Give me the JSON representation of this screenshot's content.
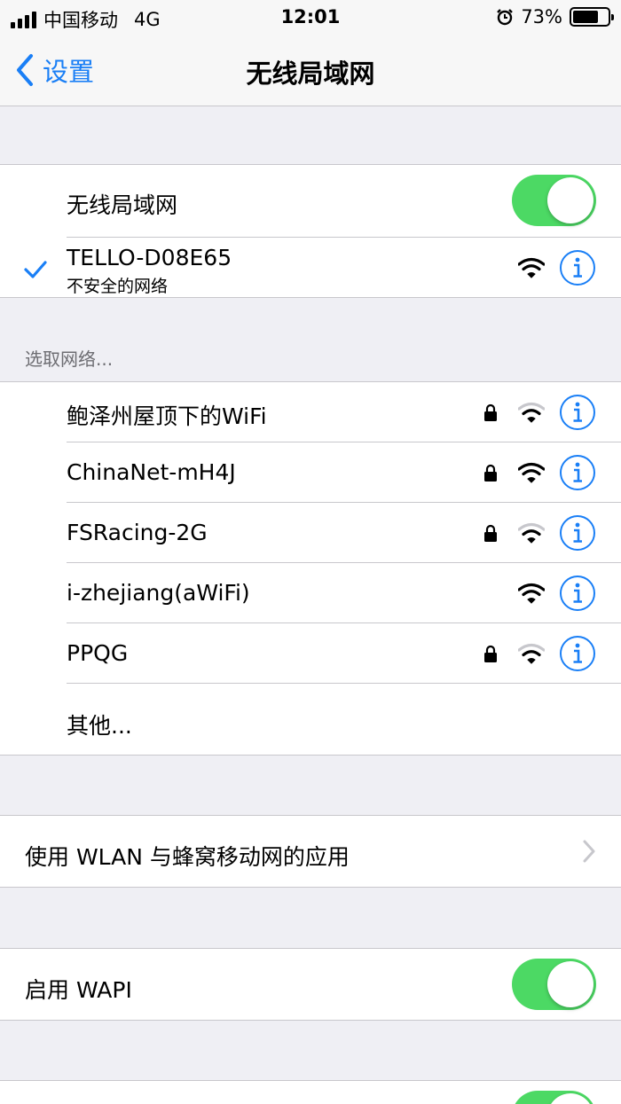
{
  "status_bar": {
    "carrier": "中国移动",
    "network": "4G",
    "time": "12:01",
    "battery": "73%",
    "battery_level": 0.73
  },
  "nav": {
    "back_label": "设置",
    "title": "无线局域网"
  },
  "wlan_toggle": {
    "label": "无线局域网",
    "on": true
  },
  "connected": {
    "ssid": "TELLO-D08E65",
    "subtitle": "不安全的网络",
    "locked": false,
    "signal": "full"
  },
  "choose_header": "选取网络...",
  "networks": [
    {
      "ssid": "鲍泽州屋顶下的WiFi",
      "locked": true,
      "signal": "medium"
    },
    {
      "ssid": "ChinaNet-mH4J",
      "locked": true,
      "signal": "full"
    },
    {
      "ssid": "FSRacing-2G",
      "locked": true,
      "signal": "medium"
    },
    {
      "ssid": "i-zhejiang(aWiFi)",
      "locked": false,
      "signal": "full"
    },
    {
      "ssid": "PPQG",
      "locked": true,
      "signal": "medium"
    }
  ],
  "other_label": "其他...",
  "apps_row": {
    "label": "使用 WLAN 与蜂窝移动网的应用"
  },
  "wapi": {
    "label": "启用 WAPI",
    "on": true
  },
  "colors": {
    "accent": "#1a7ff6",
    "toggle_on": "#4cd964",
    "background": "#efeff4",
    "separator": "#c8c7cc"
  },
  "icons": {
    "checkmark": "checkmark-icon",
    "info": "info-icon",
    "wifi": "wifi-icon",
    "lock": "lock-icon",
    "chevron": "chevron-right-icon",
    "back": "chevron-left-icon"
  }
}
